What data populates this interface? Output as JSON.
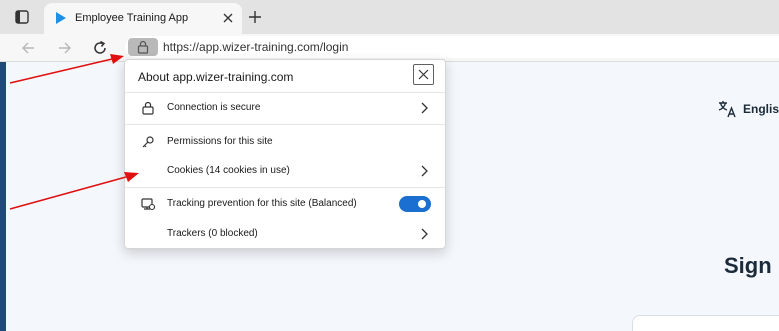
{
  "browser": {
    "tab_title": "Employee Training App",
    "url": "https://app.wizer-training.com/login"
  },
  "site_info_popup": {
    "title": "About app.wizer-training.com",
    "items": [
      {
        "label": "Connection is secure",
        "icon": "lock-icon",
        "has_chevron": true
      },
      {
        "label": "Permissions for this site",
        "icon": "key-icon",
        "has_chevron": false
      },
      {
        "label": "Cookies (14 cookies in use)",
        "icon": "none",
        "has_chevron": true
      },
      {
        "label": "Tracking prevention for this site (Balanced)",
        "icon": "tracking-icon",
        "toggle_on": true
      },
      {
        "label": "Trackers (0 blocked)",
        "icon": "none",
        "has_chevron": true
      }
    ]
  },
  "page": {
    "language_label": "Englis",
    "signin_title": "Sign"
  },
  "colors": {
    "accent": "#1a6fd1",
    "annotation_arrow": "#e01010",
    "page_background": "#f4f8fc"
  }
}
